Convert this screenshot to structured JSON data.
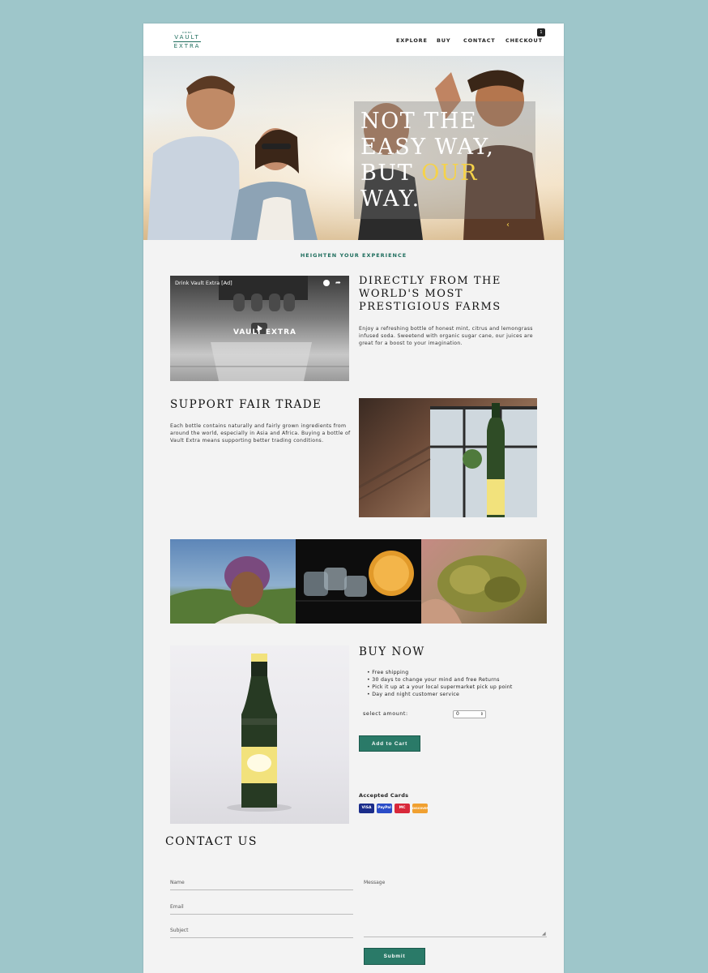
{
  "nav": {
    "logo": {
      "small": "DRINK",
      "line1": "VAULT",
      "line2": "EXTRA"
    },
    "items": [
      "EXPLORE",
      "BUY",
      "CONTACT",
      "CHECKOUT"
    ],
    "cart_count": "1"
  },
  "hero": {
    "line1": "NOT THE",
    "line2": "EASY WAY,",
    "line3a": "BUT ",
    "line3b": "OUR",
    "line4": "WAY.",
    "arrow": "‹",
    "accent_color": "#f5d24a"
  },
  "section_label": "HEIGHTEN YOUR EXPERIENCE",
  "video": {
    "title": "Drink Vault Extra [Ad]",
    "logo_text": "VAULT EXTRA"
  },
  "direct": {
    "title": "DIRECTLY FROM THE WORLD'S MOST PRESTIGIOUS FARMS",
    "text": "Enjoy a refreshing bottle of honest mint, citrus and lemongrass infused soda. Sweetend with organic sugar cane, our juices are great for a boost to your imagination."
  },
  "fair": {
    "title": "SUPPORT FAIR TRADE",
    "text": "Each bottle contains naturally and fairly grown ingredients from around the world, especially in Asia and Africa. Buying a bottle of Vault Extra means supporting better trading conditions."
  },
  "buy": {
    "title": "BUY NOW",
    "bullets": [
      "Free shipping",
      "30 days to change your mind and free Returns",
      "Pick it up at a your local supermarket pick up point",
      "Day and night customer service"
    ],
    "amount_label": "select amount:",
    "amount_value": "0",
    "add_to_cart": "Add to Cart",
    "cards_label": "Accepted Cards",
    "cards": [
      "VISA",
      "PayPal",
      "MC",
      "DISCOVER"
    ]
  },
  "contact": {
    "title": "CONTACT US",
    "name_label": "Name",
    "email_label": "Email",
    "subject_label": "Subject",
    "message_label": "Message",
    "submit": "Submit"
  },
  "colors": {
    "brand": "#1f6e5e",
    "button": "#2a7a68",
    "background": "#9ec6ca"
  }
}
